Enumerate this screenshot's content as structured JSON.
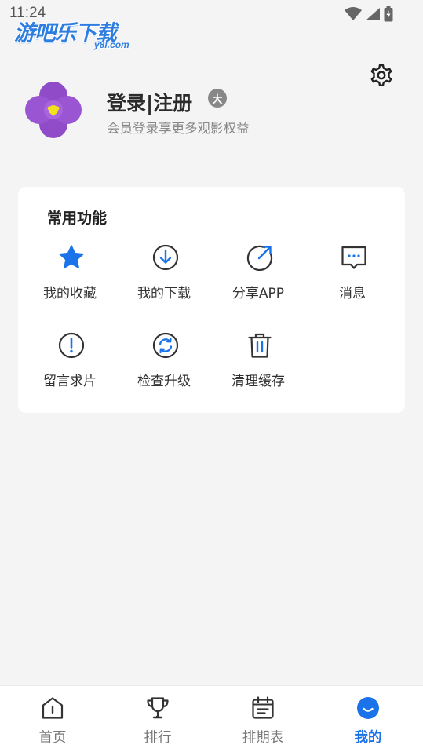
{
  "status": {
    "time": "11:24"
  },
  "watermark": {
    "brand": "游吧乐下载",
    "domain": "y8l.com"
  },
  "profile": {
    "title": "登录|注册",
    "subtitle": "会员登录享更多观影权益",
    "badge": "大"
  },
  "functions": {
    "title": "常用功能",
    "items": [
      {
        "label": "我的收藏",
        "icon": "star-icon"
      },
      {
        "label": "我的下载",
        "icon": "download-icon"
      },
      {
        "label": "分享APP",
        "icon": "share-icon"
      },
      {
        "label": "消息",
        "icon": "message-icon"
      },
      {
        "label": "留言求片",
        "icon": "exclamation-icon"
      },
      {
        "label": "检查升级",
        "icon": "refresh-icon"
      },
      {
        "label": "清理缓存",
        "icon": "trash-icon"
      }
    ]
  },
  "tabs": [
    {
      "label": "首页",
      "icon": "home-icon"
    },
    {
      "label": "排行",
      "icon": "trophy-icon"
    },
    {
      "label": "排期表",
      "icon": "calendar-icon"
    },
    {
      "label": "我的",
      "icon": "profile-icon",
      "active": true
    }
  ],
  "colors": {
    "accent": "#1a73e8",
    "background": "#f4f4f5",
    "card": "#ffffff"
  }
}
